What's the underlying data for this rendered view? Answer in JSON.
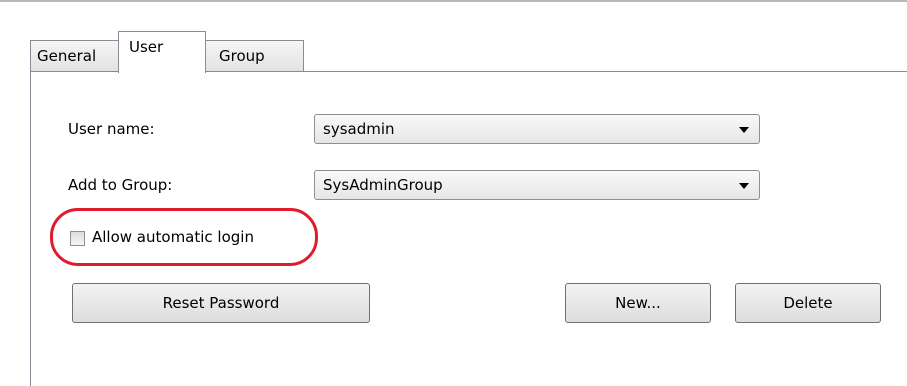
{
  "tabs": {
    "general": "General",
    "user": "User",
    "group": "Group"
  },
  "form": {
    "user_name_label": "User name:",
    "user_name_value": "sysadmin",
    "add_to_group_label": "Add to Group:",
    "add_to_group_value": "SysAdminGroup",
    "auto_login_label": "Allow automatic login",
    "auto_login_checked": false
  },
  "buttons": {
    "reset_password": "Reset Password",
    "new": "New...",
    "delete": "Delete"
  },
  "colors": {
    "highlight": "#e01b2b"
  }
}
